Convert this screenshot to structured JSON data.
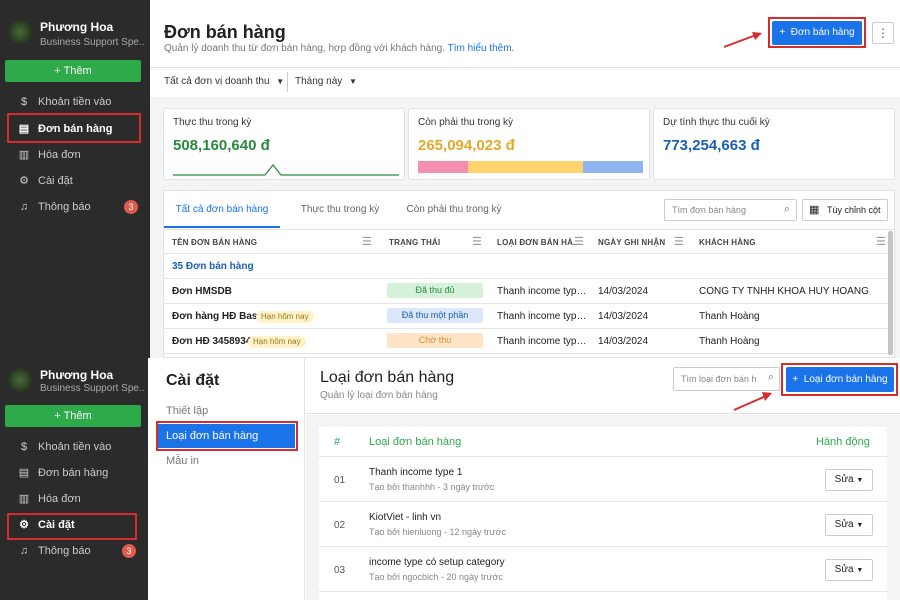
{
  "top": {
    "sidebar": {
      "org_name": "Phương Hoa",
      "org_sub": "Business Support Spe...",
      "add_label": "+ Thêm",
      "items": [
        {
          "label": "Khoản tiền vào",
          "icon": "money-icon"
        },
        {
          "label": "Đơn bán hàng",
          "icon": "document-icon"
        },
        {
          "label": "Hóa đơn",
          "icon": "invoice-icon"
        },
        {
          "label": "Cài đặt",
          "icon": "gear-icon"
        },
        {
          "label": "Thông báo",
          "icon": "bell-icon",
          "badge": "3"
        }
      ]
    },
    "header": {
      "title": "Đơn bán hàng",
      "subtitle": "Quản lý doanh thu từ đơn bán hàng, hợp đồng với khách hàng.",
      "link": "Tìm hiểu thêm.",
      "new_button": "Đơn bán hàng",
      "more": "⋮"
    },
    "filters": {
      "unit": "Tất cả đơn vị doanh thu",
      "period": "Tháng này"
    },
    "cards": [
      {
        "label": "Thực thu trong kỳ",
        "value": "508,160,640 đ",
        "color": "#2a8a3e"
      },
      {
        "label": "Còn phải thu trong kỳ",
        "value": "265,094,023 đ",
        "color": "#e3a92b"
      },
      {
        "label": "Dự tính thực thu cuối kỳ",
        "value": "773,254,663 đ",
        "color": "#1a5fb4"
      }
    ],
    "tabs": [
      "Tất cả đơn bán hàng",
      "Thực thu trong kỳ",
      "Còn phải thu trong kỳ"
    ],
    "search_placeholder": "Tìm đơn bán hàng",
    "columns_button": "Tùy chỉnh cột",
    "table": {
      "headers": [
        "TÊN ĐƠN BÁN HÀNG",
        "TRẠNG THÁI",
        "LOẠI ĐƠN BÁN HÀ...",
        "NGÀY GHI NHẬN",
        "KHÁCH HÀNG"
      ],
      "count_label": "35 Đơn bán hàng",
      "rows": [
        {
          "name": "Đơn HMSDB",
          "tag": "",
          "status": "Đã thu đủ",
          "type": "Thanh income type...",
          "date": "14/03/2024",
          "customer": "CÔNG TY TNHH KHOÁ HUY HOÀNG"
        },
        {
          "name": "Đơn hàng HĐ Base",
          "tag": "Hạn hôm nay",
          "status": "Đã thu một phần",
          "type": "Thanh income type...",
          "date": "14/03/2024",
          "customer": "Thanh Hoàng"
        },
        {
          "name": "Đơn HĐ 3458934",
          "tag": "Hạn hôm nay",
          "status": "Chờ thu",
          "type": "Thanh income type...",
          "date": "14/03/2024",
          "customer": "Thanh Hoàng"
        }
      ]
    }
  },
  "bottom": {
    "sidebar": {
      "org_name": "Phương Hoa",
      "org_sub": "Business Support Spe...",
      "add_label": "+ Thêm",
      "items": [
        {
          "label": "Khoản tiền vào",
          "icon": "money-icon"
        },
        {
          "label": "Đơn bán hàng",
          "icon": "document-icon"
        },
        {
          "label": "Hóa đơn",
          "icon": "invoice-icon"
        },
        {
          "label": "Cài đặt",
          "icon": "gear-icon"
        },
        {
          "label": "Thông báo",
          "icon": "bell-icon",
          "badge": "3"
        }
      ]
    },
    "settings_nav": {
      "title": "Cài đặt",
      "items": [
        "Thiết lập",
        "Loại đơn bán hàng",
        "Mẫu in"
      ]
    },
    "header": {
      "title": "Loại đơn bán hàng",
      "subtitle": "Quản lý loại đơn bán hàng",
      "search_placeholder": "Tìm loại đơn bán h",
      "new_button": "Loại đơn bán hàng"
    },
    "table": {
      "col_num": "#",
      "col_name": "Loại đơn bán hàng",
      "col_action": "Hành động",
      "edit_label": "Sửa",
      "rows": [
        {
          "num": "01",
          "name": "Thanh income type 1",
          "sub": "Tạo bởi thanhhh - 3 ngày trước"
        },
        {
          "num": "02",
          "name": "KiotViet - linh vn",
          "sub": "Tạo bởi hienluong - 12 ngày trước"
        },
        {
          "num": "03",
          "name": "income type có setup category",
          "sub": "Tạo bởi ngocbich - 20 ngày trước"
        }
      ]
    }
  }
}
